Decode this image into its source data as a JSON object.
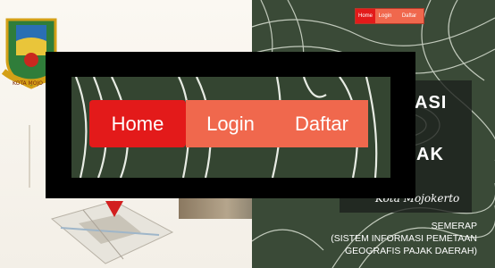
{
  "navigation": {
    "items": [
      {
        "label": "Home",
        "active": true
      },
      {
        "label": "Login",
        "active": false
      },
      {
        "label": "Daftar",
        "active": false
      }
    ],
    "colors": {
      "active": "#e31a1a",
      "inactive": "#f0684d"
    }
  },
  "hero": {
    "title_partial_1": "ASI",
    "title_partial_2": "AK",
    "signature": "Kota Mojokerto",
    "app_name": "SEMERAP",
    "description_line_1": "(SISTEM INFORMASI PEMETAAN",
    "description_line_2": "GEOGRAFIS PAJAK DAERAH)"
  },
  "emblem": {
    "text": "KOTA MOJO"
  },
  "colors": {
    "panel_dark": "#3a4a37",
    "accent_red": "#e31a1a"
  }
}
